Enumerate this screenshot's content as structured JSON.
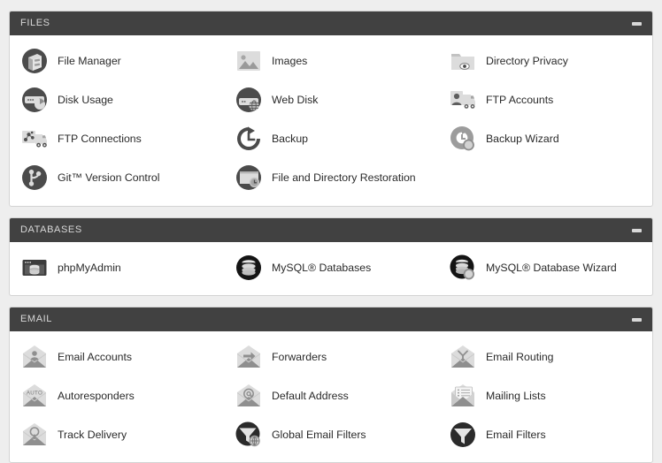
{
  "theme": {
    "page_background": "#eeeeee",
    "panel_background": "#ffffff",
    "panel_border": "#d3d3d3",
    "header_background": "#414141",
    "header_text": "#d8d8d8",
    "label_text": "#2a2a2a",
    "icon_dark": "#4a4a4a",
    "icon_light": "#c9c9c9"
  },
  "panels": [
    {
      "id": "files",
      "title": "FILES",
      "collapse_label": "collapse-icon",
      "items": [
        {
          "label": "File Manager",
          "icon": "file-manager-icon"
        },
        {
          "label": "Images",
          "icon": "images-icon"
        },
        {
          "label": "Directory Privacy",
          "icon": "directory-privacy-icon"
        },
        {
          "label": "Disk Usage",
          "icon": "disk-usage-icon"
        },
        {
          "label": "Web Disk",
          "icon": "web-disk-icon"
        },
        {
          "label": "FTP Accounts",
          "icon": "ftp-accounts-icon"
        },
        {
          "label": "FTP Connections",
          "icon": "ftp-connections-icon"
        },
        {
          "label": "Backup",
          "icon": "backup-icon"
        },
        {
          "label": "Backup Wizard",
          "icon": "backup-wizard-icon"
        },
        {
          "label": "Git™ Version Control",
          "icon": "git-version-control-icon"
        },
        {
          "label": "File and Directory Restoration",
          "icon": "file-directory-restoration-icon"
        }
      ]
    },
    {
      "id": "databases",
      "title": "DATABASES",
      "collapse_label": "collapse-icon",
      "items": [
        {
          "label": "phpMyAdmin",
          "icon": "phpmyadmin-icon"
        },
        {
          "label": "MySQL® Databases",
          "icon": "mysql-databases-icon"
        },
        {
          "label": "MySQL® Database Wizard",
          "icon": "mysql-database-wizard-icon"
        }
      ]
    },
    {
      "id": "email",
      "title": "EMAIL",
      "collapse_label": "collapse-icon",
      "items": [
        {
          "label": "Email Accounts",
          "icon": "email-accounts-icon"
        },
        {
          "label": "Forwarders",
          "icon": "forwarders-icon"
        },
        {
          "label": "Email Routing",
          "icon": "email-routing-icon"
        },
        {
          "label": "Autoresponders",
          "icon": "autoresponders-icon"
        },
        {
          "label": "Default Address",
          "icon": "default-address-icon"
        },
        {
          "label": "Mailing Lists",
          "icon": "mailing-lists-icon"
        },
        {
          "label": "Track Delivery",
          "icon": "track-delivery-icon"
        },
        {
          "label": "Global Email Filters",
          "icon": "global-email-filters-icon"
        },
        {
          "label": "Email Filters",
          "icon": "email-filters-icon"
        }
      ]
    }
  ]
}
